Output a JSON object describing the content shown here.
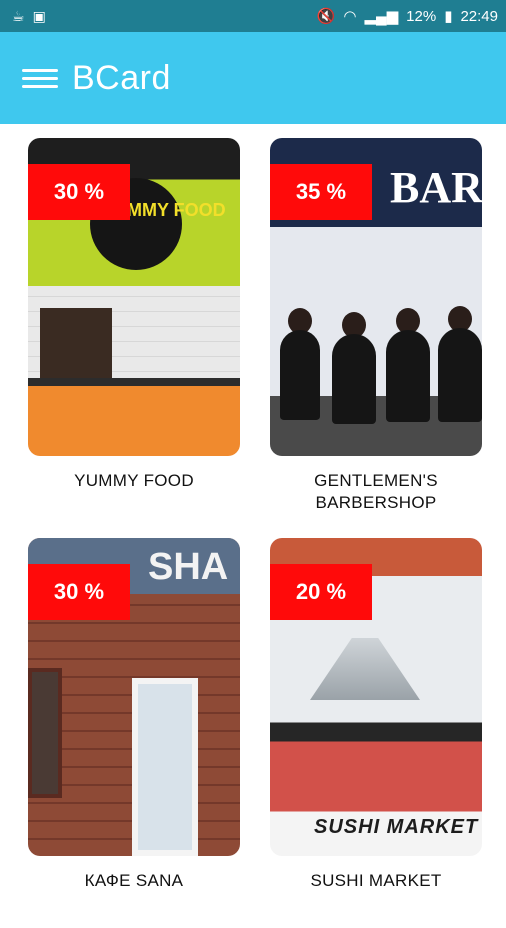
{
  "status_bar": {
    "battery": "12%",
    "time": "22:49"
  },
  "app_bar": {
    "title": "BCard"
  },
  "cards": [
    {
      "name": "YUMMY FOOD",
      "discount": "30 %",
      "scene_text": "YUMMY FOOD"
    },
    {
      "name": "GENTLEMEN'S BARBERSHOP",
      "discount": "35 %",
      "scene_text": "BAR"
    },
    {
      "name": "КАФЕ SANA",
      "discount": "30 %",
      "scene_text": "SHA"
    },
    {
      "name": "SUSHI MARKET",
      "discount": "20 %",
      "scene_text": "SUSHI MARKET"
    }
  ],
  "colors": {
    "status_bar": "#1f7e92",
    "app_bar": "#3fc8ee",
    "badge": "#ff0a0a"
  }
}
